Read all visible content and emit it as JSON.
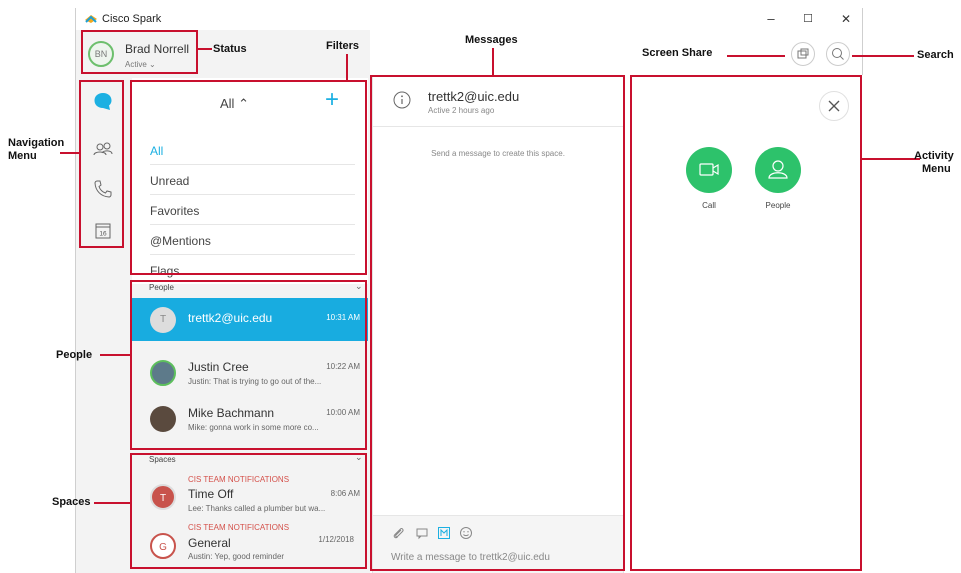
{
  "window": {
    "title": "Cisco Spark",
    "minimize": "–",
    "maximize": "☐",
    "close": "✕"
  },
  "user": {
    "initials": "BN",
    "name": "Brad Norrell",
    "status": "Active"
  },
  "nav": {
    "icons": [
      "chat-icon",
      "people-icon",
      "phone-icon",
      "calendar-icon"
    ],
    "calendar_day": "16"
  },
  "filters": {
    "header": "All",
    "add": "+",
    "items": [
      "All",
      "Unread",
      "Favorites",
      "@Mentions",
      "Flags"
    ],
    "accent": "#1cb0e2"
  },
  "people": {
    "section": "People",
    "rows": [
      {
        "initial": "T",
        "name": "trettk2@uic.edu",
        "time": "10:31 AM",
        "preview": ""
      },
      {
        "initial": "",
        "name": "Justin Cree",
        "time": "10:22 AM",
        "preview": "Justin: That is trying to go out of the..."
      },
      {
        "initial": "",
        "name": "Mike Bachmann",
        "time": "10:00 AM",
        "preview": "Mike: gonna work in some more co..."
      }
    ]
  },
  "spaces": {
    "section": "Spaces",
    "rows": [
      {
        "team": "CIS TEAM NOTIFICATIONS",
        "initial": "T",
        "name": "Time Off",
        "time": "8:06 AM",
        "preview": "Lee: Thanks called a plumber but wa..."
      },
      {
        "team": "CIS TEAM NOTIFICATIONS",
        "initial": "G",
        "name": "General",
        "time": "1/12/2018",
        "preview": "Austin: Yep, good reminder"
      }
    ]
  },
  "messages": {
    "recipient": "trettk2@uic.edu",
    "active": "Active 2 hours ago",
    "hint": "Send a message to create this space.",
    "placeholder": "Write a message to trettk2@uic.edu"
  },
  "activity": {
    "call": "Call",
    "people": "People",
    "accent": "#2dc26b"
  },
  "annotations": {
    "status": "Status",
    "filters": "Filters",
    "messages": "Messages",
    "screen_share": "Screen Share",
    "search": "Search",
    "navigation_line1": "Navigation",
    "navigation_line2": "Menu",
    "activity_line1": "Activity",
    "activity_line2": "Menu",
    "people": "People",
    "spaces": "Spaces",
    "color": "#c8102e"
  }
}
